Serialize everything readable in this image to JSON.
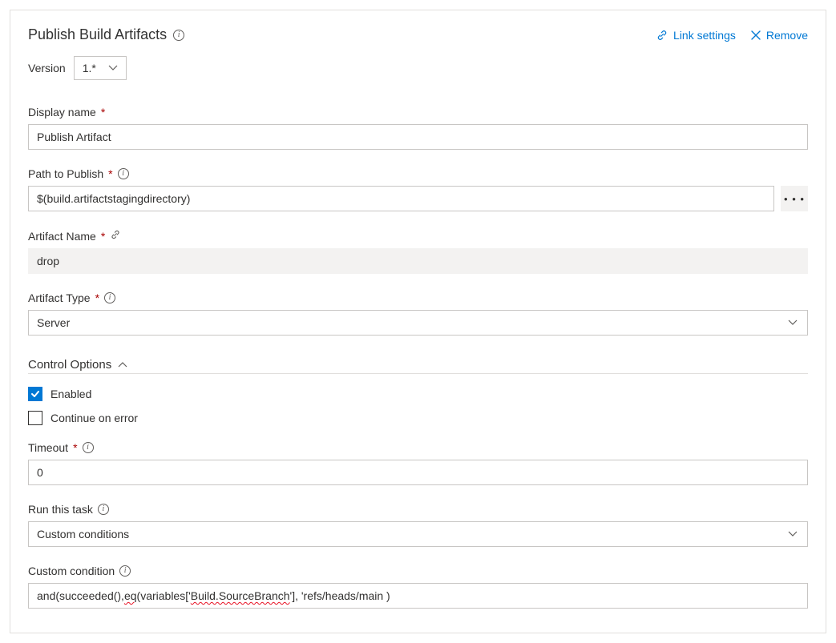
{
  "header": {
    "title": "Publish Build Artifacts",
    "link_settings": "Link settings",
    "remove": "Remove"
  },
  "version": {
    "label": "Version",
    "value": "1.*"
  },
  "fields": {
    "display_name": {
      "label": "Display name",
      "value": "Publish Artifact"
    },
    "path_to_publish": {
      "label": "Path to Publish",
      "value": "$(build.artifactstagingdirectory)"
    },
    "artifact_name": {
      "label": "Artifact Name",
      "value": "drop"
    },
    "artifact_type": {
      "label": "Artifact Type",
      "value": "Server"
    }
  },
  "control_options": {
    "header": "Control Options",
    "enabled_label": "Enabled",
    "enabled_checked": true,
    "continue_on_error_label": "Continue on error",
    "continue_on_error_checked": false,
    "timeout": {
      "label": "Timeout",
      "value": "0"
    },
    "run_this_task": {
      "label": "Run this task",
      "value": "Custom conditions"
    },
    "custom_condition": {
      "label": "Custom condition",
      "prefix": "and(succeeded(), ",
      "wavy1": "eq",
      "mid": "(variables['",
      "wavy2": "Build.SourceBranch",
      "suffix": "'], 'refs/heads/main )"
    }
  }
}
